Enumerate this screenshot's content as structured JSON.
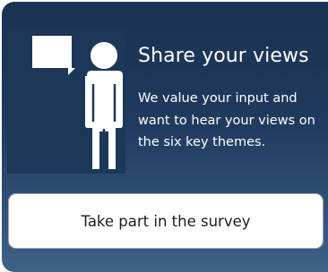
{
  "panel": {
    "title": "Share your views",
    "description": "We value your input and want to hear your views on the six key themes.",
    "button_label": "Take part in the survey",
    "illustration_icon": "person-with-speech-bubble-icon"
  },
  "colors": {
    "panel_top": "#1b3252",
    "panel_bottom": "#3f6289",
    "text": "#ffffff",
    "button_bg": "#ffffff",
    "button_text": "#1c1c1c"
  }
}
